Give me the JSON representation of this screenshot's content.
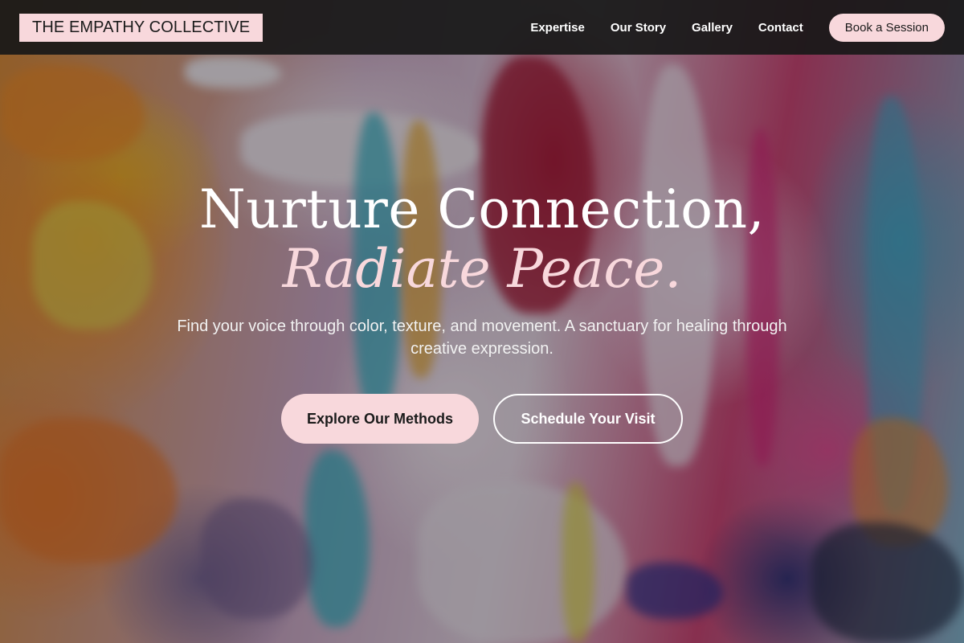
{
  "header": {
    "brand": "THE EMPATHY COLLECTIVE",
    "nav": [
      {
        "label": "Expertise"
      },
      {
        "label": "Our Story"
      },
      {
        "label": "Gallery"
      },
      {
        "label": "Contact"
      }
    ],
    "book_label": "Book a Session"
  },
  "hero": {
    "headline_line1": "Nurture Connection,",
    "headline_line2": "Radiate Peace.",
    "subheadline": "Find your voice through color, texture, and movement. A sanctuary for healing through creative expression.",
    "primary_cta": "Explore Our Methods",
    "secondary_cta": "Schedule Your Visit"
  },
  "colors": {
    "accent_pink": "#f8d8dc",
    "header_bg": "#181818",
    "text_white": "#ffffff"
  }
}
